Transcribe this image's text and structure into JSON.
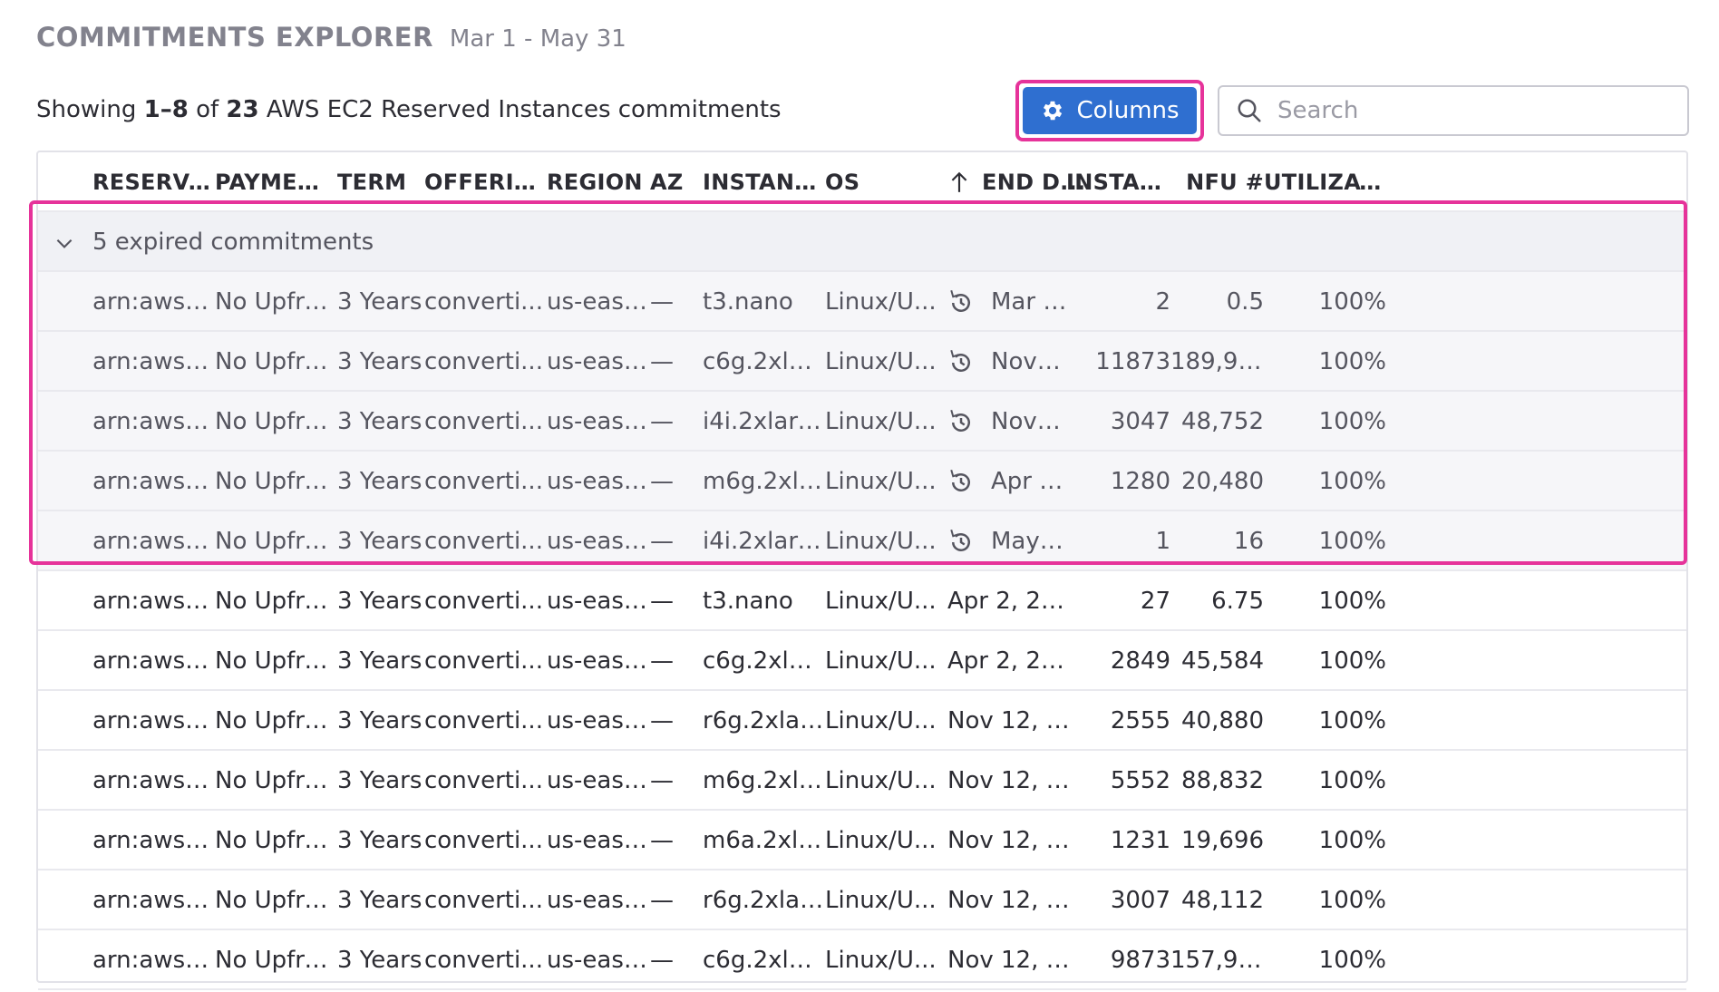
{
  "header": {
    "title": "COMMITMENTS EXPLORER",
    "range": "Mar 1 - May 31"
  },
  "summary": {
    "prefix": "Showing ",
    "range": "1–8",
    "of": " of ",
    "total": "23",
    "suffix": " AWS EC2 Reserved Instances commitments"
  },
  "toolbar": {
    "columns_label": "Columns"
  },
  "search": {
    "placeholder": "Search"
  },
  "table": {
    "headers": [
      "RESERVAT...",
      "PAYMENT...",
      "TERM",
      "OFFERIN...",
      "REGION",
      "AZ",
      "INSTANC...",
      "OS",
      "END D...",
      "INSTANC...",
      "NFU #",
      "UTILIZATI..."
    ],
    "group": {
      "label": "5 expired commitments"
    },
    "expired_rows": [
      [
        "arn:aws:...",
        "No Upfro...",
        "3 Years",
        "converti...",
        "us-east-1",
        "—",
        "t3.nano",
        "Linux/U...",
        "Mar 1, 2026",
        "2",
        "0.5",
        "100%"
      ],
      [
        "arn:aws:...",
        "No Upfro...",
        "3 Years",
        "converti...",
        "us-east-1",
        "—",
        "c6g.2xlar...",
        "Linux/U...",
        "Nov 12, 2025",
        "11873",
        "189,968",
        "100%"
      ],
      [
        "arn:aws:...",
        "No Upfro...",
        "3 Years",
        "converti...",
        "us-east-1",
        "—",
        "i4i.2xlarge",
        "Linux/U...",
        "Nov 12, 2025",
        "3047",
        "48,752",
        "100%"
      ],
      [
        "arn:aws:...",
        "No Upfro...",
        "3 Years",
        "converti...",
        "us-east-1",
        "—",
        "m6g.2xla...",
        "Linux/U...",
        "Apr 2, 2026",
        "1280",
        "20,480",
        "100%"
      ],
      [
        "arn:aws:...",
        "No Upfro...",
        "3 Years",
        "converti...",
        "us-east-1",
        "—",
        "i4i.2xlarge",
        "Linux/U...",
        "May 5, 2026",
        "1",
        "16",
        "100%"
      ]
    ],
    "rows": [
      [
        "arn:aws:...",
        "No Upfro...",
        "3 Years",
        "converti...",
        "us-east-1",
        "—",
        "t3.nano",
        "Linux/U...",
        "Apr 2, 2026",
        "27",
        "6.75",
        "100%"
      ],
      [
        "arn:aws:...",
        "No Upfro...",
        "3 Years",
        "converti...",
        "us-east-1",
        "—",
        "c6g.2xlar...",
        "Linux/U...",
        "Apr 2, 2026",
        "2849",
        "45,584",
        "100%"
      ],
      [
        "arn:aws:...",
        "No Upfro...",
        "3 Years",
        "converti...",
        "us-east-1",
        "—",
        "r6g.2xlar...",
        "Linux/U...",
        "Nov 12, 2026",
        "2555",
        "40,880",
        "100%"
      ],
      [
        "arn:aws:...",
        "No Upfro...",
        "3 Years",
        "converti...",
        "us-east-1",
        "—",
        "m6g.2xla...",
        "Linux/U...",
        "Nov 12, 2026",
        "5552",
        "88,832",
        "100%"
      ],
      [
        "arn:aws:...",
        "No Upfro...",
        "3 Years",
        "converti...",
        "us-east-1",
        "—",
        "m6a.2xla...",
        "Linux/U...",
        "Nov 12, 2026",
        "1231",
        "19,696",
        "100%"
      ],
      [
        "arn:aws:...",
        "No Upfro...",
        "3 Years",
        "converti...",
        "us-east-1",
        "—",
        "r6g.2xlar...",
        "Linux/U...",
        "Nov 12, 2026",
        "3007",
        "48,112",
        "100%"
      ],
      [
        "arn:aws:...",
        "No Upfro...",
        "3 Years",
        "converti...",
        "us-east-1",
        "—",
        "c6g.2xlar...",
        "Linux/U...",
        "Nov 12, 2026",
        "9873",
        "157,968",
        "100%"
      ]
    ]
  },
  "icons": {
    "columns": "gear-icon",
    "search": "search-icon",
    "group_toggle": "chevron-down-icon",
    "sort": "arrow-up-icon",
    "expired": "history-icon"
  },
  "colors": {
    "accent": "#2f6fd0",
    "highlight": "#e6339a"
  }
}
